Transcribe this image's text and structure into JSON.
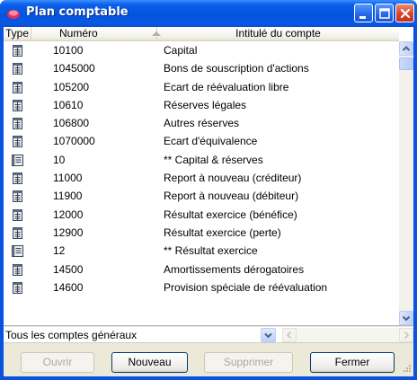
{
  "window": {
    "title": "Plan comptable"
  },
  "table": {
    "headers": {
      "type": "Type",
      "numero": "Numéro",
      "intitule": "Intitulé du compte"
    },
    "sort": {
      "column": "numero",
      "direction": "ascending"
    },
    "rows": [
      {
        "kind": "account",
        "numero": "10100",
        "intitule": "Capital"
      },
      {
        "kind": "account",
        "numero": "1045000",
        "intitule": "Bons de souscription d'actions"
      },
      {
        "kind": "account",
        "numero": "105200",
        "intitule": "Ecart de réévaluation libre"
      },
      {
        "kind": "account",
        "numero": "10610",
        "intitule": "Réserves légales"
      },
      {
        "kind": "account",
        "numero": "106800",
        "intitule": "Autres réserves"
      },
      {
        "kind": "account",
        "numero": "1070000",
        "intitule": "Ecart d'équivalence"
      },
      {
        "kind": "total",
        "numero": "10",
        "intitule": "** Capital & réserves"
      },
      {
        "kind": "account",
        "numero": "11000",
        "intitule": "Report à nouveau (créditeur)"
      },
      {
        "kind": "account",
        "numero": "11900",
        "intitule": "Report à nouveau (débiteur)"
      },
      {
        "kind": "account",
        "numero": "12000",
        "intitule": "Résultat exercice (bénéfice)"
      },
      {
        "kind": "account",
        "numero": "12900",
        "intitule": "Résultat exercice (perte)"
      },
      {
        "kind": "total",
        "numero": "12",
        "intitule": "** Résultat exercice"
      },
      {
        "kind": "account",
        "numero": "14500",
        "intitule": "Amortissements dérogatoires"
      },
      {
        "kind": "account",
        "numero": "14600",
        "intitule": "Provision spéciale de réévaluation"
      }
    ]
  },
  "filter": {
    "selected": "Tous les comptes généraux"
  },
  "buttons": {
    "ouvrir": "Ouvrir",
    "nouveau": "Nouveau",
    "supprimer": "Supprimer",
    "fermer": "Fermer"
  },
  "icons": {
    "app": "app-icon",
    "account": "account-icon",
    "total": "total-account-icon"
  },
  "colors": {
    "titlebar": "#0553dd",
    "close_button": "#d8452b",
    "window_face": "#ece9d8",
    "disabled_text": "#aca899"
  }
}
